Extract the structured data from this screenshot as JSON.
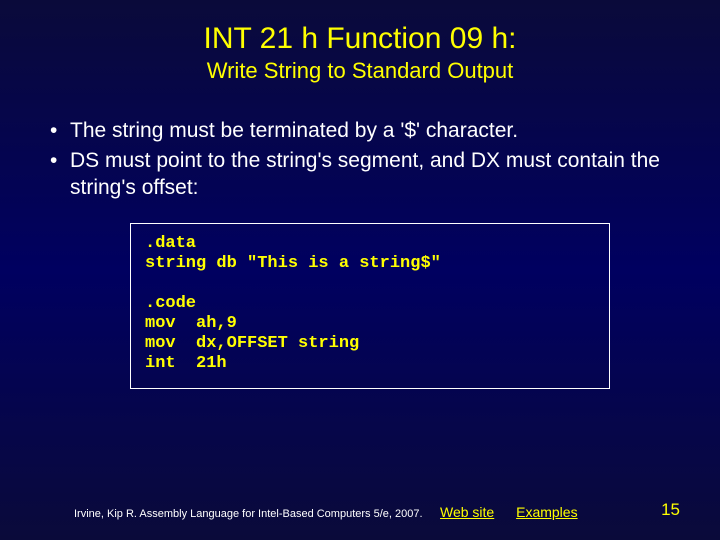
{
  "title": "INT 21 h Function 09 h:",
  "subtitle": "Write String to Standard Output",
  "bullets": [
    "The string must be terminated by a '$' character.",
    "DS must point to the string's segment, and DX must contain the string's offset:"
  ],
  "code": ".data\nstring db \"This is a string$\"\n\n.code\nmov  ah,9\nmov  dx,OFFSET string\nint  21h",
  "footer": {
    "citation": "Irvine, Kip R. Assembly Language for Intel-Based Computers 5/e, 2007.",
    "link_web": "Web site",
    "link_examples": "Examples",
    "page": "15"
  }
}
